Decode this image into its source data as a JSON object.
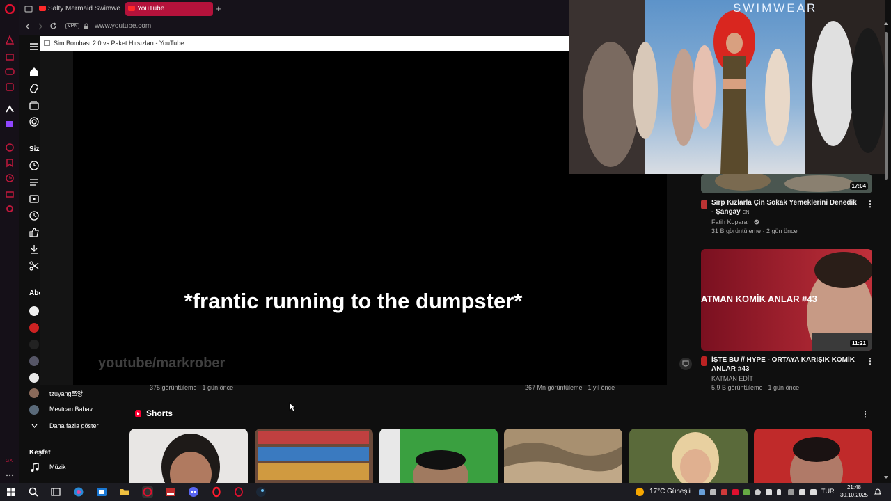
{
  "browser": {
    "tabs": [
      {
        "title": "Salty Mermaid Swimwea"
      },
      {
        "title": "YouTube"
      }
    ],
    "new_tab": "+",
    "vpn": "VPN",
    "url": "www.youtube.com"
  },
  "miniplayer": {
    "title": "Sim Bombası 2.0 vs Paket Hırsızları - YouTube"
  },
  "video": {
    "subtitle": "*frantic running to the dumpster*",
    "watermark": "youtube/markrober"
  },
  "pip": {
    "brand": "SWIMWEAR"
  },
  "guide": {
    "section_you": "Siz",
    "section_subs": "Abo",
    "subscriptions": [
      {
        "name": "tzuyang쯔양"
      },
      {
        "name": "Mevtcan Bahav"
      }
    ],
    "show_more": "Daha fazla göster",
    "section_explore": "Keşfet",
    "music": "Müzik"
  },
  "under_video": {
    "left_meta": "375 görüntüleme · 1 gün önce",
    "right_meta": "267 Mn görüntüleme · 1 yıl önce"
  },
  "recommendations": [
    {
      "duration": "17:04",
      "title": "Sırp Kızlarla Çin Sokak Yemeklerini Denedik - Şangay",
      "title_badge": "CN",
      "channel": "Fatih Koparan",
      "meta": "31 B görüntüleme · 2 gün önce"
    },
    {
      "duration": "11:21",
      "thumb_text": "ATMAN KOMİK ANLAR #43",
      "title": "İŞTE BU // HYPE - ORTAYA KARIŞIK KOMİK ANLAR #43",
      "channel": "KATMAN EDİT",
      "meta": "5,9 B görüntüleme · 1 gün önce"
    }
  ],
  "shorts": {
    "title": "Shorts",
    "menu": "⋮"
  },
  "taskbar": {
    "weather_temp": "17°C",
    "weather_desc": "Güneşli",
    "lang": "TUR",
    "time": "21:48",
    "date": "30.10.2025"
  },
  "colors": {
    "youtube_red": "#ff0000",
    "opera_red": "#b4123b",
    "background": "#0f0f0f"
  }
}
